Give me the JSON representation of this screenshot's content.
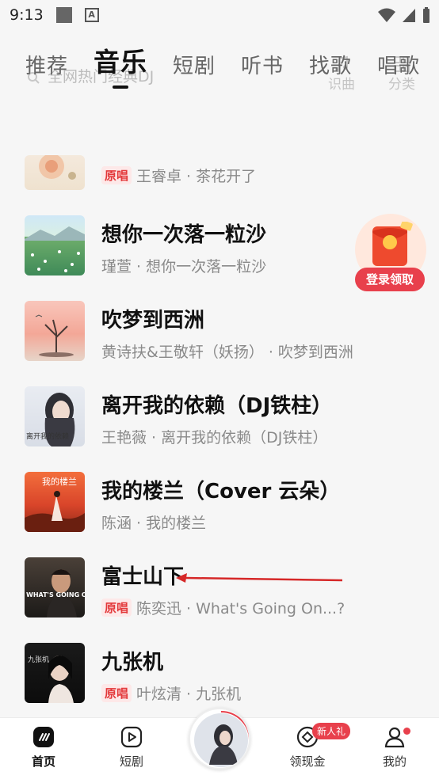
{
  "status_bar": {
    "time": "9:13",
    "a_icon": "A"
  },
  "search": {
    "placeholder": "全网热门经典DJ"
  },
  "header_actions": [
    {
      "label": "识曲",
      "icon": "music-note-icon"
    },
    {
      "label": "分类",
      "icon": "category-icon"
    }
  ],
  "tabs": [
    {
      "label": "推荐",
      "active": false
    },
    {
      "label": "音乐",
      "active": true
    },
    {
      "label": "短剧",
      "active": false
    },
    {
      "label": "听书",
      "active": false
    },
    {
      "label": "找歌",
      "active": false
    },
    {
      "label": "唱歌",
      "active": false
    }
  ],
  "songs": [
    {
      "title": "",
      "badge": "原唱",
      "artist_song": "王睿卓 · 茶花开了"
    },
    {
      "title": "想你一次落一粒沙",
      "badge": "",
      "artist_song": "瑾萱 · 想你一次落一粒沙"
    },
    {
      "title": "吹梦到西洲",
      "badge": "",
      "artist_song": "黄诗扶&王敬轩（妖扬） · 吹梦到西洲"
    },
    {
      "title": "离开我的依赖（DJ铁柱）",
      "badge": "",
      "artist_song": "王艳薇 · 离开我的依赖（DJ铁柱）"
    },
    {
      "title": "我的楼兰（Cover 云朵）",
      "badge": "",
      "artist_song": "陈涵 · 我的楼兰"
    },
    {
      "title": "富士山下",
      "badge": "原唱",
      "artist_song": "陈奕迅 · What's Going On...?"
    },
    {
      "title": "九张机",
      "badge": "原唱",
      "artist_song": "叶炫清 · 九张机"
    }
  ],
  "cover_texts": {
    "s4": "离开我的依赖",
    "s5": "我的楼兰",
    "s6": "WHAT'S GOING ON...?",
    "s7": "九张机"
  },
  "promo": {
    "label": "登录领取"
  },
  "bottom_nav": [
    {
      "label": "首页",
      "active": true
    },
    {
      "label": "短剧",
      "active": false
    },
    {
      "label": "领现金",
      "badge": "新人礼",
      "active": false
    },
    {
      "label": "我的",
      "active": false
    }
  ],
  "colors": {
    "accent": "#e8404c",
    "badge_bg": "#fde8e8",
    "annotation_arrow": "#d62828"
  }
}
